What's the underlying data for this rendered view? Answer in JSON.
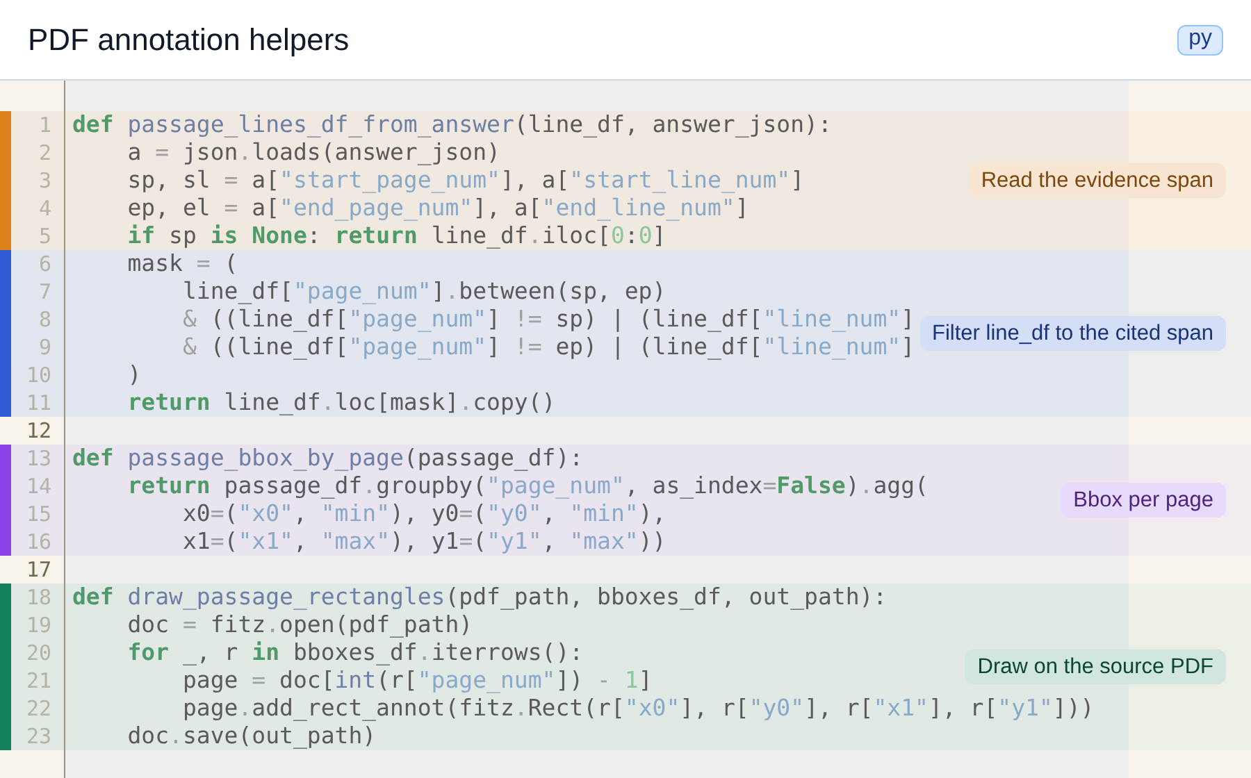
{
  "title": "PDF annotation helpers",
  "language_badge": "py",
  "sections": [
    {
      "kind": "block",
      "color": "#e0821c",
      "note": "Read the evidence span",
      "lines": [
        {
          "number": "1",
          "code": [
            {
              "kind": "kw",
              "text": "def"
            },
            {
              "kind": "fn",
              "text": " passage_lines_df_from_answer"
            },
            {
              "kind": "p",
              "text": "(line_df, answer_json):"
            }
          ]
        },
        {
          "number": "2",
          "code": [
            {
              "kind": "p",
              "text": "    a "
            },
            {
              "kind": "op",
              "text": "="
            },
            {
              "kind": "p",
              "text": " json"
            },
            {
              "kind": "op",
              "text": "."
            },
            {
              "kind": "p",
              "text": "loads(answer_json)"
            }
          ]
        },
        {
          "number": "3",
          "code": [
            {
              "kind": "p",
              "text": "    sp, sl "
            },
            {
              "kind": "op",
              "text": "="
            },
            {
              "kind": "p",
              "text": " a["
            },
            {
              "kind": "s",
              "text": "\"start_page_num\""
            },
            {
              "kind": "p",
              "text": "], a["
            },
            {
              "kind": "s",
              "text": "\"start_line_num\""
            },
            {
              "kind": "p",
              "text": "]"
            }
          ]
        },
        {
          "number": "4",
          "code": [
            {
              "kind": "p",
              "text": "    ep, el "
            },
            {
              "kind": "op",
              "text": "="
            },
            {
              "kind": "p",
              "text": " a["
            },
            {
              "kind": "s",
              "text": "\"end_page_num\""
            },
            {
              "kind": "p",
              "text": "], a["
            },
            {
              "kind": "s",
              "text": "\"end_line_num\""
            },
            {
              "kind": "p",
              "text": "]"
            }
          ]
        },
        {
          "number": "5",
          "code": [
            {
              "kind": "kw",
              "text": "    if"
            },
            {
              "kind": "p",
              "text": " sp "
            },
            {
              "kind": "kw",
              "text": "is"
            },
            {
              "kind": "kw",
              "text": " None"
            },
            {
              "kind": "p",
              "text": ": "
            },
            {
              "kind": "kw",
              "text": "return"
            },
            {
              "kind": "p",
              "text": " line_df"
            },
            {
              "kind": "op",
              "text": "."
            },
            {
              "kind": "p",
              "text": "iloc["
            },
            {
              "kind": "n",
              "text": "0"
            },
            {
              "kind": "p",
              "text": ":"
            },
            {
              "kind": "n",
              "text": "0"
            },
            {
              "kind": "p",
              "text": "]"
            }
          ]
        }
      ]
    },
    {
      "kind": "block",
      "color": "#2f5bd6",
      "note": "Filter line_df to the cited span",
      "lines": [
        {
          "number": "6",
          "code": [
            {
              "kind": "p",
              "text": "    mask "
            },
            {
              "kind": "op",
              "text": "="
            },
            {
              "kind": "p",
              "text": " ("
            }
          ]
        },
        {
          "number": "7",
          "code": [
            {
              "kind": "p",
              "text": "        line_df["
            },
            {
              "kind": "s",
              "text": "\"page_num\""
            },
            {
              "kind": "p",
              "text": "]"
            },
            {
              "kind": "op",
              "text": "."
            },
            {
              "kind": "p",
              "text": "between(sp, ep)"
            }
          ]
        },
        {
          "number": "8",
          "code": [
            {
              "kind": "op",
              "text": "        &"
            },
            {
              "kind": "p",
              "text": " ((line_df["
            },
            {
              "kind": "s",
              "text": "\"page_num\""
            },
            {
              "kind": "p",
              "text": "] "
            },
            {
              "kind": "op",
              "text": "!="
            },
            {
              "kind": "p",
              "text": " sp) | (line_df["
            },
            {
              "kind": "s",
              "text": "\"line_num\""
            },
            {
              "kind": "p",
              "text": "]"
            }
          ]
        },
        {
          "number": "9",
          "code": [
            {
              "kind": "op",
              "text": "        &"
            },
            {
              "kind": "p",
              "text": " ((line_df["
            },
            {
              "kind": "s",
              "text": "\"page_num\""
            },
            {
              "kind": "p",
              "text": "] "
            },
            {
              "kind": "op",
              "text": "!="
            },
            {
              "kind": "p",
              "text": " ep) | (line_df["
            },
            {
              "kind": "s",
              "text": "\"line_num\""
            },
            {
              "kind": "p",
              "text": "]"
            }
          ]
        },
        {
          "number": "10",
          "code": [
            {
              "kind": "p",
              "text": "    )"
            }
          ]
        },
        {
          "number": "11",
          "code": [
            {
              "kind": "kw",
              "text": "    return"
            },
            {
              "kind": "p",
              "text": " line_df"
            },
            {
              "kind": "op",
              "text": "."
            },
            {
              "kind": "p",
              "text": "loc[mask]"
            },
            {
              "kind": "op",
              "text": "."
            },
            {
              "kind": "p",
              "text": "copy()"
            }
          ]
        }
      ]
    },
    {
      "kind": "blank",
      "lines": [
        {
          "number": "12"
        }
      ]
    },
    {
      "kind": "block",
      "color": "#8a44e8",
      "note": "Bbox per page",
      "lines": [
        {
          "number": "13",
          "code": [
            {
              "kind": "kw",
              "text": "def"
            },
            {
              "kind": "fn",
              "text": " passage_bbox_by_page"
            },
            {
              "kind": "p",
              "text": "(passage_df):"
            }
          ]
        },
        {
          "number": "14",
          "code": [
            {
              "kind": "kw",
              "text": "    return"
            },
            {
              "kind": "p",
              "text": " passage_df"
            },
            {
              "kind": "op",
              "text": "."
            },
            {
              "kind": "p",
              "text": "groupby("
            },
            {
              "kind": "s",
              "text": "\"page_num\""
            },
            {
              "kind": "p",
              "text": ", as_index"
            },
            {
              "kind": "op",
              "text": "="
            },
            {
              "kind": "kw",
              "text": "False"
            },
            {
              "kind": "p",
              "text": ")"
            },
            {
              "kind": "op",
              "text": "."
            },
            {
              "kind": "p",
              "text": "agg("
            }
          ]
        },
        {
          "number": "15",
          "code": [
            {
              "kind": "p",
              "text": "        x0"
            },
            {
              "kind": "op",
              "text": "="
            },
            {
              "kind": "p",
              "text": "("
            },
            {
              "kind": "s",
              "text": "\"x0\""
            },
            {
              "kind": "p",
              "text": ", "
            },
            {
              "kind": "s",
              "text": "\"min\""
            },
            {
              "kind": "p",
              "text": "), y0"
            },
            {
              "kind": "op",
              "text": "="
            },
            {
              "kind": "p",
              "text": "("
            },
            {
              "kind": "s",
              "text": "\"y0\""
            },
            {
              "kind": "p",
              "text": ", "
            },
            {
              "kind": "s",
              "text": "\"min\""
            },
            {
              "kind": "p",
              "text": "),"
            }
          ]
        },
        {
          "number": "16",
          "code": [
            {
              "kind": "p",
              "text": "        x1"
            },
            {
              "kind": "op",
              "text": "="
            },
            {
              "kind": "p",
              "text": "("
            },
            {
              "kind": "s",
              "text": "\"x1\""
            },
            {
              "kind": "p",
              "text": ", "
            },
            {
              "kind": "s",
              "text": "\"max\""
            },
            {
              "kind": "p",
              "text": "), y1"
            },
            {
              "kind": "op",
              "text": "="
            },
            {
              "kind": "p",
              "text": "("
            },
            {
              "kind": "s",
              "text": "\"y1\""
            },
            {
              "kind": "p",
              "text": ", "
            },
            {
              "kind": "s",
              "text": "\"max\""
            },
            {
              "kind": "p",
              "text": "))"
            }
          ]
        }
      ]
    },
    {
      "kind": "blank",
      "lines": [
        {
          "number": "17"
        }
      ]
    },
    {
      "kind": "block",
      "color": "#12805f",
      "note": "Draw on the source PDF",
      "lines": [
        {
          "number": "18",
          "code": [
            {
              "kind": "kw",
              "text": "def"
            },
            {
              "kind": "fn",
              "text": " draw_passage_rectangles"
            },
            {
              "kind": "p",
              "text": "(pdf_path, bboxes_df, out_path):"
            }
          ]
        },
        {
          "number": "19",
          "code": [
            {
              "kind": "p",
              "text": "    doc "
            },
            {
              "kind": "op",
              "text": "="
            },
            {
              "kind": "p",
              "text": " fitz"
            },
            {
              "kind": "op",
              "text": "."
            },
            {
              "kind": "p",
              "text": "open(pdf_path)"
            }
          ]
        },
        {
          "number": "20",
          "code": [
            {
              "kind": "kw",
              "text": "    for"
            },
            {
              "kind": "p",
              "text": " _, r "
            },
            {
              "kind": "kw",
              "text": "in"
            },
            {
              "kind": "p",
              "text": " bboxes_df"
            },
            {
              "kind": "op",
              "text": "."
            },
            {
              "kind": "p",
              "text": "iterrows():"
            }
          ]
        },
        {
          "number": "21",
          "code": [
            {
              "kind": "p",
              "text": "        page "
            },
            {
              "kind": "op",
              "text": "="
            },
            {
              "kind": "p",
              "text": " doc["
            },
            {
              "kind": "fn",
              "text": "int"
            },
            {
              "kind": "p",
              "text": "(r["
            },
            {
              "kind": "s",
              "text": "\"page_num\""
            },
            {
              "kind": "p",
              "text": "]) "
            },
            {
              "kind": "op",
              "text": "-"
            },
            {
              "kind": "n",
              "text": " 1"
            },
            {
              "kind": "p",
              "text": "]"
            }
          ]
        },
        {
          "number": "22",
          "code": [
            {
              "kind": "p",
              "text": "        page"
            },
            {
              "kind": "op",
              "text": "."
            },
            {
              "kind": "p",
              "text": "add_rect_annot(fitz"
            },
            {
              "kind": "op",
              "text": "."
            },
            {
              "kind": "p",
              "text": "Rect(r["
            },
            {
              "kind": "s",
              "text": "\"x0\""
            },
            {
              "kind": "p",
              "text": "], r["
            },
            {
              "kind": "s",
              "text": "\"y0\""
            },
            {
              "kind": "p",
              "text": "], r["
            },
            {
              "kind": "s",
              "text": "\"x1\""
            },
            {
              "kind": "p",
              "text": "], r["
            },
            {
              "kind": "s",
              "text": "\"y1\""
            },
            {
              "kind": "p",
              "text": "]))"
            }
          ]
        },
        {
          "number": "23",
          "code": [
            {
              "kind": "p",
              "text": "    doc"
            },
            {
              "kind": "op",
              "text": "."
            },
            {
              "kind": "p",
              "text": "save(out_path)"
            }
          ]
        }
      ]
    }
  ]
}
